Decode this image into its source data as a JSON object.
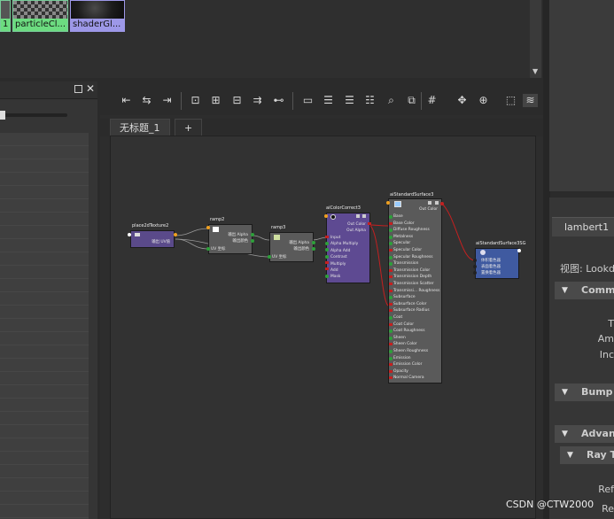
{
  "browser": {
    "thumbnails": [
      {
        "label": "1",
        "color": "#6cdc80"
      },
      {
        "label": "particleCl...",
        "color": "#6cdc80"
      },
      {
        "label": "shaderGl...",
        "color": "#9d98e8"
      }
    ]
  },
  "left_panel": {
    "float_icon": "float-window-icon",
    "close_icon": "close-icon"
  },
  "toolbar": {
    "icons": [
      "graph-input-icon",
      "graph-input-output-icon",
      "graph-output-icon",
      "frame-selection-icon",
      "add-selected-icon",
      "remove-selected-icon",
      "graph-upstream-icon",
      "graph-downstream-icon",
      "layout-simple-icon",
      "layout-connected-icon",
      "layout-full-icon",
      "layout-custom-icon",
      "search-icon",
      "bookmark-icon",
      "grid-icon",
      "snap-icon",
      "shader-swatch-icon",
      "frame-icon",
      "settings-icon"
    ]
  },
  "tabs": {
    "active": "无标题_1",
    "add": "+"
  },
  "nodes": {
    "place2d": {
      "title": "place2dTexture2",
      "rows_right": [
        "输出 UV值"
      ]
    },
    "ramp2": {
      "title": "ramp2",
      "rows_right": [
        "输出 Alpha",
        "输出颜色"
      ],
      "rows_left": [
        "UV 坐标"
      ]
    },
    "ramp3": {
      "title": "ramp3",
      "rows_right": [
        "输出 Alpha",
        "输出颜色"
      ],
      "rows_left": [
        "UV 坐标"
      ]
    },
    "colorcorrect": {
      "title": "aiColorCorrect3",
      "rows_right": [
        "Out Color",
        "Out Alpha"
      ],
      "rows_left": [
        "Input",
        "Alpha Multiply",
        "Alpha Add",
        "Contrast",
        "Multiply",
        "Add",
        "Mask"
      ]
    },
    "standard": {
      "title": "aiStandardSurface3",
      "rows_right": [
        "Out Color"
      ],
      "rows_left": [
        "Base",
        "Base Color",
        "Diffuse Roughness",
        "Metalness",
        "Specular",
        "Specular Color",
        "Specular Roughness",
        "Transmission",
        "Transmission Color",
        "Transmission Depth",
        "Transmission Scatter",
        "Transmissi... Roughness",
        "Subsurface",
        "Subsurface Color",
        "Subsurface Radius",
        "Coat",
        "Coat Color",
        "Coat Roughness",
        "Sheen",
        "Sheen Color",
        "Sheen Roughness",
        "Emission",
        "Emission Color",
        "Opacity",
        "Normal Camera"
      ]
    },
    "sg": {
      "title": "aiStandardSurface3SG",
      "rows_left": [
        "体积着色器",
        "表面着色器",
        "置换着色器"
      ]
    }
  },
  "attr": {
    "tab_label": "lambert1",
    "view_label": "视图: Lookd",
    "sections": [
      "Comm",
      "Bump",
      "Advan",
      "Ray T"
    ],
    "labels": [
      "T",
      "Am",
      "Inc",
      "Ref",
      "Re"
    ]
  },
  "watermark": "CSDN @CTW2000"
}
